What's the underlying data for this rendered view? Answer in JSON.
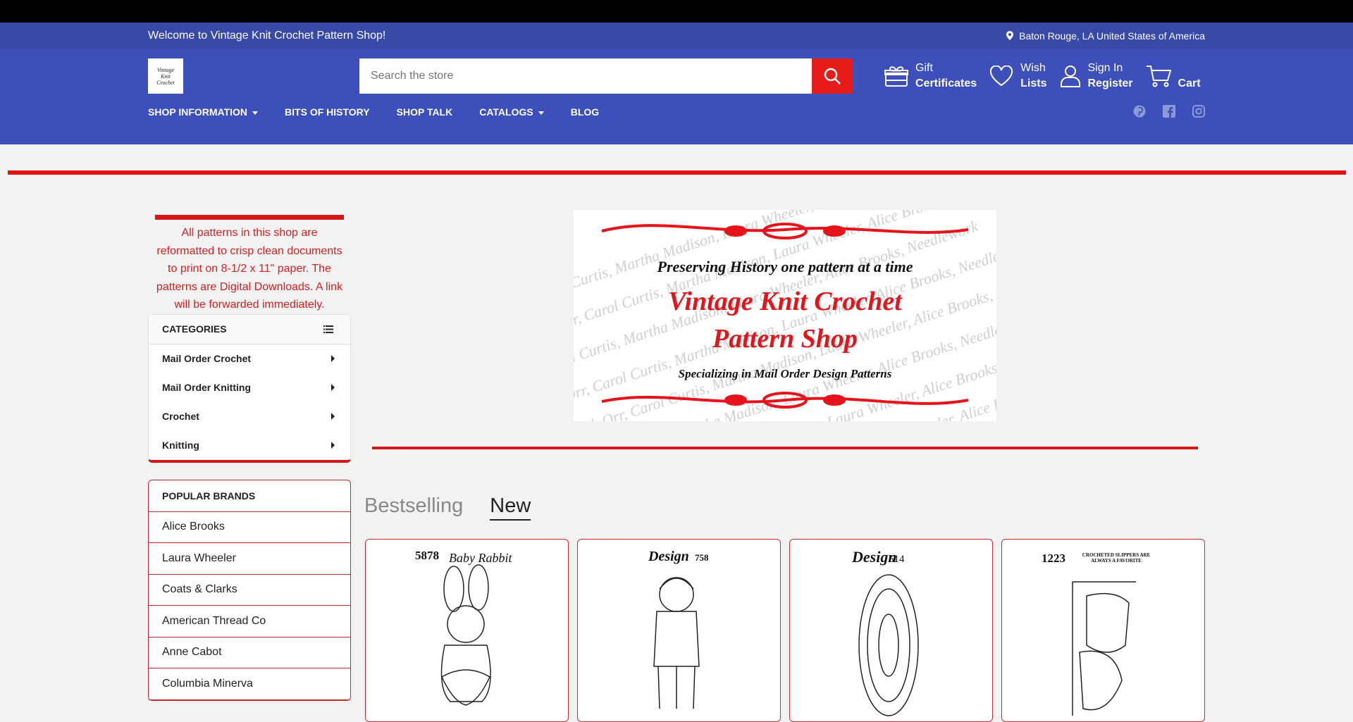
{
  "topbar": {
    "welcome": "Welcome to Vintage Knit Crochet Pattern Shop!",
    "location": "Baton Rouge, LA United States of America"
  },
  "logo": {
    "line1": "Vintage",
    "line2": "Knit",
    "line3": "Crochet"
  },
  "search": {
    "placeholder": "Search the store"
  },
  "header_nav": {
    "gift_top": "Gift",
    "gift_bottom": "Certificates",
    "wish_top": "Wish",
    "wish_bottom": "Lists",
    "signin_top": "Sign In",
    "signin_bottom": "Register",
    "cart": "Cart"
  },
  "menu": {
    "items": [
      "SHOP INFORMATION",
      "BITS OF HISTORY",
      "SHOP TALK",
      "CATALOGS",
      "BLOG"
    ]
  },
  "sidebar": {
    "notice": "All patterns in this shop are reformatted to crisp clean documents to print on  8-1/2 x 11\" paper. The patterns are Digital Downloads.   A link will be forwarded immediately.",
    "categories_title": "CATEGORIES",
    "categories": [
      "Mail Order Crochet",
      "Mail Order Knitting",
      "Crochet",
      "Knitting"
    ],
    "brands_title": "POPULAR BRANDS",
    "brands": [
      "Alice Brooks",
      "Laura Wheeler",
      "Coats & Clarks",
      "American Thread Co",
      "Anne Cabot",
      "Columbia Minerva"
    ]
  },
  "banner": {
    "line1": "Preserving History one pattern at a time",
    "line2": "Vintage Knit Crochet",
    "line3": "Pattern Shop",
    "line4": "Specializing in Mail Order Design Patterns",
    "watermark": "Ruth Orr, Carol Curtis, Martha Madison, Laura Wheeler, Alice Brooks, Needlework"
  },
  "tabs": {
    "bestselling": "Bestselling",
    "new": "New"
  },
  "products": [
    {
      "code": "5878",
      "title": "Baby Rabbit"
    },
    {
      "code": "Design",
      "title": "758"
    },
    {
      "code": "Design",
      "title": "514"
    },
    {
      "code": "1223",
      "title": "CROCHETED SLIPPERS ARE ALWAYS A FAVORITE"
    }
  ],
  "colors": {
    "nav_bg": "#3c4fba",
    "accent_red": "#e31313",
    "search_btn": "#e81b1b"
  }
}
